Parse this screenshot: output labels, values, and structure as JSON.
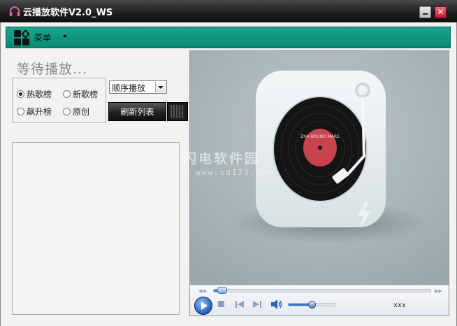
{
  "window": {
    "title": "云播放软件V2.0_WS",
    "close_glyph": "✕",
    "accent_color": "#078a73"
  },
  "menu": {
    "label": "菜单"
  },
  "status": {
    "text": "等待播放..."
  },
  "charts_radio": {
    "options": [
      {
        "label": "热歌榜",
        "selected": true
      },
      {
        "label": "新歌榜",
        "selected": false
      },
      {
        "label": "飙升榜",
        "selected": false
      },
      {
        "label": "原创",
        "selected": false
      }
    ]
  },
  "play_mode": {
    "value": "顺序播放"
  },
  "refresh": {
    "label": "刷新列表"
  },
  "player": {
    "time": "xxx",
    "seek_progress": 0.04,
    "volume_level": 0.5
  },
  "watermark": {
    "site_name": "闪电软件园",
    "url": "www.sd173.com"
  },
  "cover": {
    "record_label_text": "ZHA BRUNO MARS"
  }
}
